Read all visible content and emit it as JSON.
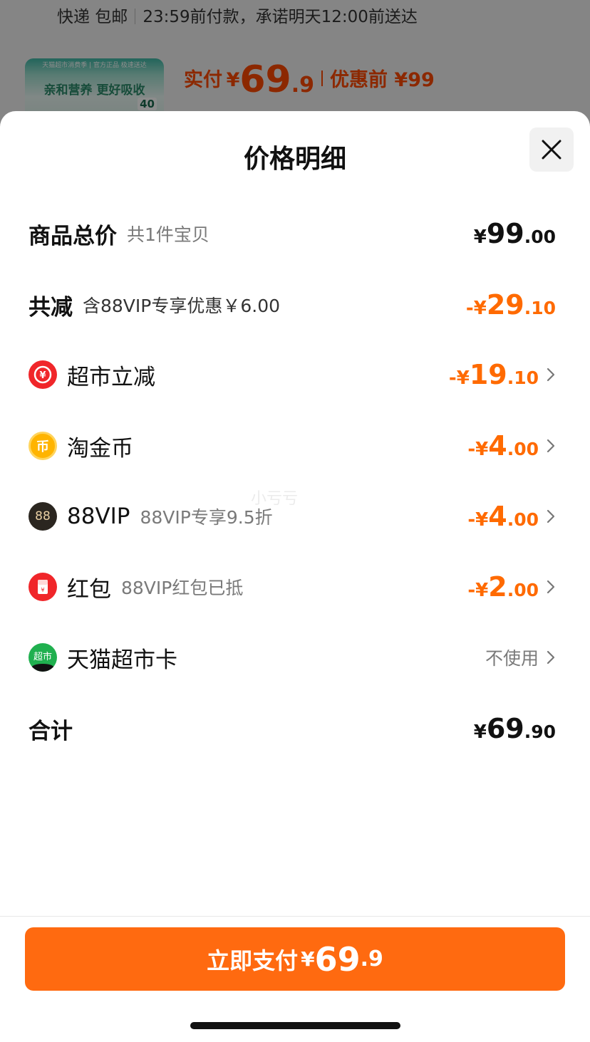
{
  "background": {
    "delivery_method": "快递 包邮",
    "delivery_note": "23:59前付款，承诺明天12:00前送达",
    "thumb_banner": "天猫超市消费季 | 官方正品 极速送达",
    "thumb_slogan": "亲和营养 更好吸收",
    "thumb_badge": "40",
    "paid_label": "实付",
    "paid_currency": "¥",
    "paid_int": "69",
    "paid_dec": ".9",
    "before_discount": "优惠前 ¥99"
  },
  "sheet": {
    "title": "价格明细",
    "close_icon": "close-icon",
    "watermark": "小亏亏"
  },
  "rows": {
    "total": {
      "label": "商品总价",
      "sub": "共1件宝贝",
      "currency": "¥",
      "int": "99",
      "dec": ".00"
    },
    "reduce": {
      "label": "共减",
      "sub": "含88VIP专享优惠￥6.00",
      "currency": "-¥",
      "int": "29",
      "dec": ".10"
    },
    "supermarket": {
      "icon": "yuan-coupon-icon",
      "label": "超市立减",
      "currency": "-¥",
      "int": "19",
      "dec": ".10"
    },
    "coins": {
      "icon": "gold-coin-icon",
      "icon_text": "币",
      "label": "淘金币",
      "currency": "-¥",
      "int": "4",
      "dec": ".00"
    },
    "vip": {
      "icon": "88vip-icon",
      "icon_text": "88",
      "label": "88VIP",
      "sub": "88VIP专享9.5折",
      "currency": "-¥",
      "int": "4",
      "dec": ".00"
    },
    "redpacket": {
      "icon": "red-packet-icon",
      "label": "红包",
      "sub": "88VIP红包已抵",
      "currency": "-¥",
      "int": "2",
      "dec": ".00"
    },
    "card": {
      "icon": "tmall-card-icon",
      "icon_text": "超市",
      "label": "天猫超市卡",
      "value": "不使用"
    },
    "sum": {
      "label": "合计",
      "currency": "¥",
      "int": "69",
      "dec": ".90"
    }
  },
  "pay_button": {
    "label": "立即支付",
    "currency": "¥",
    "int": "69",
    "dec": ".9"
  },
  "colors": {
    "accent": "#ff6a00",
    "button": "#ff6a10",
    "text": "#111111",
    "muted": "#7a7a7a"
  }
}
